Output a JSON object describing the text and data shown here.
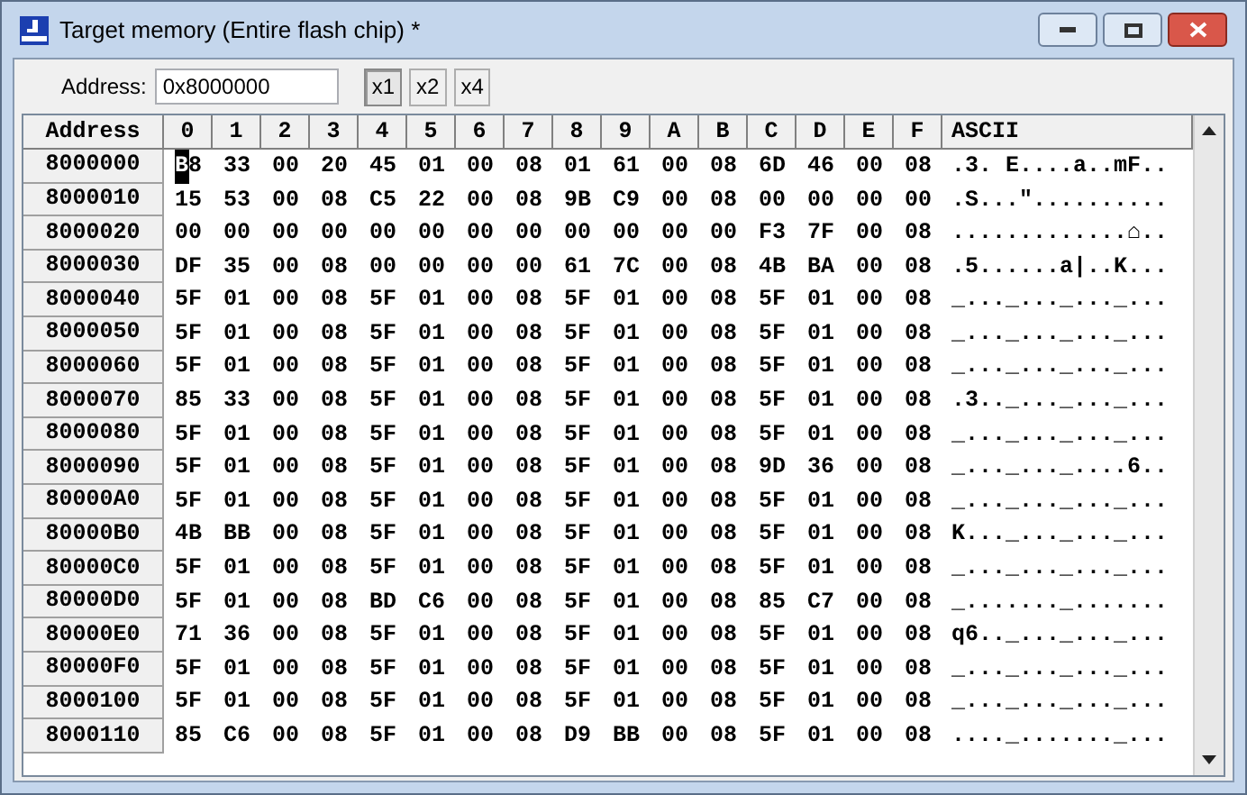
{
  "window": {
    "title": "Target memory (Entire flash chip) *"
  },
  "toolbar": {
    "address_label": "Address:",
    "address_value": "0x8000000",
    "zoom_buttons": [
      {
        "label": "x1",
        "selected": true
      },
      {
        "label": "x2",
        "selected": false
      },
      {
        "label": "x4",
        "selected": false
      }
    ]
  },
  "table": {
    "columns": [
      "Address",
      "0",
      "1",
      "2",
      "3",
      "4",
      "5",
      "6",
      "7",
      "8",
      "9",
      "A",
      "B",
      "C",
      "D",
      "E",
      "F",
      "ASCII"
    ],
    "rows": [
      {
        "address": "8000000",
        "bytes": [
          "B8",
          "33",
          "00",
          "20",
          "45",
          "01",
          "00",
          "08",
          "01",
          "61",
          "00",
          "08",
          "6D",
          "46",
          "00",
          "08"
        ],
        "ascii": ".3. E....a..mF..",
        "cursor": true
      },
      {
        "address": "8000010",
        "bytes": [
          "15",
          "53",
          "00",
          "08",
          "C5",
          "22",
          "00",
          "08",
          "9B",
          "C9",
          "00",
          "08",
          "00",
          "00",
          "00",
          "00"
        ],
        "ascii": ".S...\"..........",
        "cursor": false
      },
      {
        "address": "8000020",
        "bytes": [
          "00",
          "00",
          "00",
          "00",
          "00",
          "00",
          "00",
          "00",
          "00",
          "00",
          "00",
          "00",
          "F3",
          "7F",
          "00",
          "08"
        ],
        "ascii": ".............⌂..",
        "cursor": false
      },
      {
        "address": "8000030",
        "bytes": [
          "DF",
          "35",
          "00",
          "08",
          "00",
          "00",
          "00",
          "00",
          "61",
          "7C",
          "00",
          "08",
          "4B",
          "BA",
          "00",
          "08"
        ],
        "ascii": ".5......a|..K...",
        "cursor": false
      },
      {
        "address": "8000040",
        "bytes": [
          "5F",
          "01",
          "00",
          "08",
          "5F",
          "01",
          "00",
          "08",
          "5F",
          "01",
          "00",
          "08",
          "5F",
          "01",
          "00",
          "08"
        ],
        "ascii": "_..._..._..._...",
        "cursor": false
      },
      {
        "address": "8000050",
        "bytes": [
          "5F",
          "01",
          "00",
          "08",
          "5F",
          "01",
          "00",
          "08",
          "5F",
          "01",
          "00",
          "08",
          "5F",
          "01",
          "00",
          "08"
        ],
        "ascii": "_..._..._..._...",
        "cursor": false
      },
      {
        "address": "8000060",
        "bytes": [
          "5F",
          "01",
          "00",
          "08",
          "5F",
          "01",
          "00",
          "08",
          "5F",
          "01",
          "00",
          "08",
          "5F",
          "01",
          "00",
          "08"
        ],
        "ascii": "_..._..._..._...",
        "cursor": false
      },
      {
        "address": "8000070",
        "bytes": [
          "85",
          "33",
          "00",
          "08",
          "5F",
          "01",
          "00",
          "08",
          "5F",
          "01",
          "00",
          "08",
          "5F",
          "01",
          "00",
          "08"
        ],
        "ascii": ".3.._..._..._...",
        "cursor": false
      },
      {
        "address": "8000080",
        "bytes": [
          "5F",
          "01",
          "00",
          "08",
          "5F",
          "01",
          "00",
          "08",
          "5F",
          "01",
          "00",
          "08",
          "5F",
          "01",
          "00",
          "08"
        ],
        "ascii": "_..._..._..._...",
        "cursor": false
      },
      {
        "address": "8000090",
        "bytes": [
          "5F",
          "01",
          "00",
          "08",
          "5F",
          "01",
          "00",
          "08",
          "5F",
          "01",
          "00",
          "08",
          "9D",
          "36",
          "00",
          "08"
        ],
        "ascii": "_..._..._....6..",
        "cursor": false
      },
      {
        "address": "80000A0",
        "bytes": [
          "5F",
          "01",
          "00",
          "08",
          "5F",
          "01",
          "00",
          "08",
          "5F",
          "01",
          "00",
          "08",
          "5F",
          "01",
          "00",
          "08"
        ],
        "ascii": "_..._..._..._...",
        "cursor": false
      },
      {
        "address": "80000B0",
        "bytes": [
          "4B",
          "BB",
          "00",
          "08",
          "5F",
          "01",
          "00",
          "08",
          "5F",
          "01",
          "00",
          "08",
          "5F",
          "01",
          "00",
          "08"
        ],
        "ascii": "K..._..._..._...",
        "cursor": false
      },
      {
        "address": "80000C0",
        "bytes": [
          "5F",
          "01",
          "00",
          "08",
          "5F",
          "01",
          "00",
          "08",
          "5F",
          "01",
          "00",
          "08",
          "5F",
          "01",
          "00",
          "08"
        ],
        "ascii": "_..._..._..._...",
        "cursor": false
      },
      {
        "address": "80000D0",
        "bytes": [
          "5F",
          "01",
          "00",
          "08",
          "BD",
          "C6",
          "00",
          "08",
          "5F",
          "01",
          "00",
          "08",
          "85",
          "C7",
          "00",
          "08"
        ],
        "ascii": "_......._.......",
        "cursor": false
      },
      {
        "address": "80000E0",
        "bytes": [
          "71",
          "36",
          "00",
          "08",
          "5F",
          "01",
          "00",
          "08",
          "5F",
          "01",
          "00",
          "08",
          "5F",
          "01",
          "00",
          "08"
        ],
        "ascii": "q6.._..._..._...",
        "cursor": false
      },
      {
        "address": "80000F0",
        "bytes": [
          "5F",
          "01",
          "00",
          "08",
          "5F",
          "01",
          "00",
          "08",
          "5F",
          "01",
          "00",
          "08",
          "5F",
          "01",
          "00",
          "08"
        ],
        "ascii": "_..._..._..._...",
        "cursor": false
      },
      {
        "address": "8000100",
        "bytes": [
          "5F",
          "01",
          "00",
          "08",
          "5F",
          "01",
          "00",
          "08",
          "5F",
          "01",
          "00",
          "08",
          "5F",
          "01",
          "00",
          "08"
        ],
        "ascii": "_..._..._..._...",
        "cursor": false
      },
      {
        "address": "8000110",
        "bytes": [
          "85",
          "C6",
          "00",
          "08",
          "5F",
          "01",
          "00",
          "08",
          "D9",
          "BB",
          "00",
          "08",
          "5F",
          "01",
          "00",
          "08"
        ],
        "ascii": "...._......._...",
        "cursor": false
      }
    ]
  }
}
